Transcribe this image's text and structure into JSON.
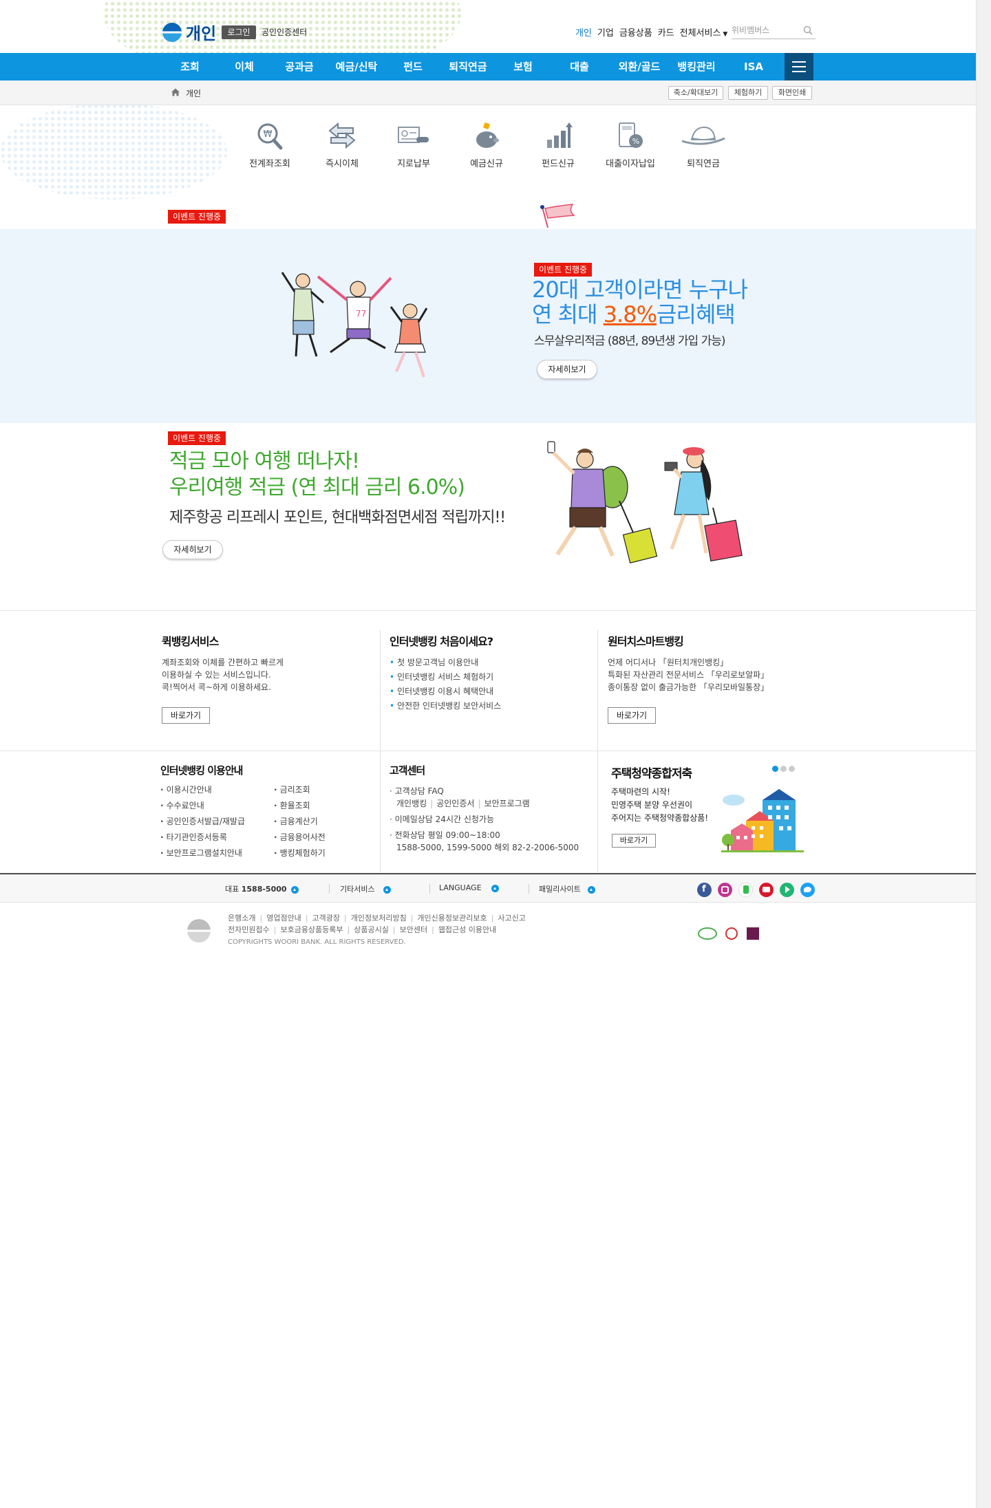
{
  "header": {
    "logo_text": "개인",
    "login_label": "로그인",
    "cert_center_label": "공인인증센터",
    "top_nav": [
      "개인",
      "기업",
      "금융상품",
      "카드",
      "전체서비스"
    ],
    "search_placeholder": "위비멤버스"
  },
  "gnb": {
    "items": [
      "조회",
      "이체",
      "공과금",
      "예금/신탁",
      "펀드",
      "퇴직연금",
      "보험",
      "대출",
      "외환/골드",
      "뱅킹관리",
      "ISA"
    ]
  },
  "location": {
    "current": "개인",
    "buttons": [
      "축소/확대보기",
      "체험하기",
      "화면인쇄"
    ]
  },
  "quick_icons": [
    "전계좌조회",
    "즉시이체",
    "지로납부",
    "예금신규",
    "펀드신규",
    "대출이자납입",
    "퇴직연금"
  ],
  "events": {
    "badge": "이벤트 진행중",
    "banner1": {
      "title_line1": "20대 고객이라면 누구나",
      "title_line2_pre": "연 최대 ",
      "title_line2_pct": "3.8%",
      "title_line2_post": "금리혜택",
      "subtitle": "스무살우리적금 (88년, 89년생 가입 가능)",
      "more_label": "자세히보기"
    },
    "banner2": {
      "title_line1": "적금 모아 여행 떠나자!",
      "title_line2": "우리여행 적금 (연 최대 금리 6.0%)",
      "subtitle": "제주항공 리프레시 포인트, 현대백화점면세점 적립까지!!",
      "more_label": "자세히보기"
    }
  },
  "services": {
    "quick": {
      "title": "퀵뱅킹서비스",
      "lines": [
        "계좌조회와 이체를 간편하고 빠르게",
        "이용하실 수 있는 서비스입니다.",
        "콕!찍어서 콕~하게 이용하세요."
      ],
      "button": "바로가기"
    },
    "first": {
      "title": "인터넷뱅킹 처음이세요?",
      "items": [
        "첫 방문고객님 이용안내",
        "인터넷뱅킹 서비스 체험하기",
        "인터넷뱅킹 이용시 혜택안내",
        "안전한 인터넷뱅킹 보안서비스"
      ]
    },
    "smart": {
      "title": "원터치스마트뱅킹",
      "lines": [
        "언제 어디서나 「원터치개인뱅킹」",
        "특화된 자산관리 전문서비스 「우리로보알파」",
        "종이통장 없이 출금가능한 「우리모바일통장」"
      ],
      "button": "바로가기"
    }
  },
  "guide": {
    "title": "인터넷뱅킹 이용안내",
    "col1": [
      "이용시간안내",
      "수수료안내",
      "공인인증서발급/재발급",
      "타기관인증서등록",
      "보안프로그램설치안내"
    ],
    "col2": [
      "금리조회",
      "환율조회",
      "금융계산기",
      "금융용어사전",
      "뱅킹체험하기"
    ]
  },
  "customer": {
    "title": "고객센터",
    "faq": "고객상담 FAQ",
    "faq_links": [
      "개인뱅킹",
      "공인인증서",
      "보안프로그램"
    ],
    "email": "이메일상담",
    "email_note": "24시간 신청가능",
    "phone": "전화상담",
    "phone_hours": "평일 09:00~18:00",
    "phone_numbers": "1588-5000, 1599-5000 해외 82-2-2006-5000"
  },
  "promo": {
    "title": "주택청약종합저축",
    "lines": [
      "주택마련의 시작!",
      "민영주택 분양 우선권이",
      "주어지는 주택청약종합상품!"
    ],
    "button": "바로가기"
  },
  "footer_bar": {
    "main_label": "대표",
    "main_number": "1588-5000",
    "items": [
      "기타서비스",
      "LANGUAGE",
      "패밀리사이트"
    ],
    "sns": [
      "facebook-icon",
      "instagram-icon",
      "blog-icon",
      "youtube-icon",
      "play-icon",
      "twitter-icon"
    ]
  },
  "footer": {
    "links_row1": [
      "은행소개",
      "영업점안내",
      "고객광장",
      "개인정보처리방침",
      "개인신용정보관리보호",
      "사고신고"
    ],
    "links_row2": [
      "전자민원접수",
      "보호금융상품등록부",
      "상품공시실",
      "보안센터",
      "웹접근성 이용안내"
    ],
    "copyright": "COPYRIGHTS WOORI BANK. ALL RIGHTS RESERVED."
  },
  "colors": {
    "brand_blue": "#0e95df",
    "dark_blue": "#084b9c",
    "event_red": "#e8190f",
    "green_title": "#3fa82f",
    "orange_highlight": "#f25a00"
  }
}
